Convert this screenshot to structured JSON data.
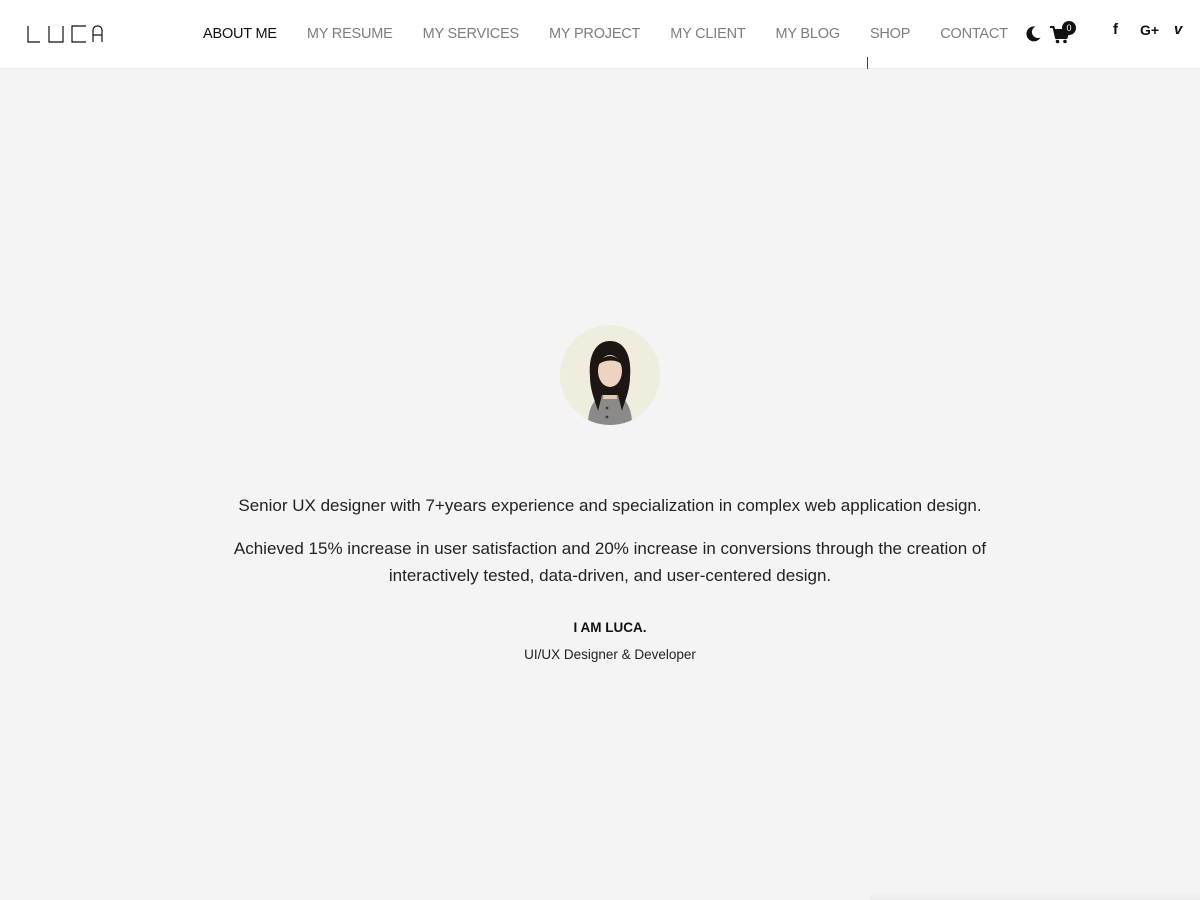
{
  "brand": {
    "logo_text": "LUCA"
  },
  "nav": {
    "items": [
      {
        "label": "ABOUT ME",
        "active": true
      },
      {
        "label": "MY RESUME",
        "active": false
      },
      {
        "label": "MY SERVICES",
        "active": false
      },
      {
        "label": "MY PROJECT",
        "active": false
      },
      {
        "label": "MY CLIENT",
        "active": false
      },
      {
        "label": "MY BLOG",
        "active": false
      },
      {
        "label": "SHOP",
        "active": false
      },
      {
        "label": "CONTACT",
        "active": false
      }
    ]
  },
  "tools": {
    "theme_toggle_icon": "moon-icon",
    "cart_icon": "shopping-cart-icon",
    "cart_count": "0"
  },
  "social": {
    "facebook_glyph": "f",
    "google_plus_glyph": "G+",
    "vimeo_glyph": "v"
  },
  "profile": {
    "avatar_icon": "avatar-photo",
    "intro_1": "Senior UX designer with 7+years experience and specialization in complex web application design.",
    "intro_2": "Achieved 15% increase in user satisfaction and 20% increase in conversions through the creation of interactively tested, data-driven, and user-centered design.",
    "name": "I AM LUCA.",
    "role": "UI/UX Designer & Developer"
  },
  "colors": {
    "background": "#f4f4f4",
    "header_bg": "#ffffff",
    "nav_active": "#111111",
    "nav_inactive": "#7d7d7d",
    "avatar_bg": "#efedde"
  }
}
